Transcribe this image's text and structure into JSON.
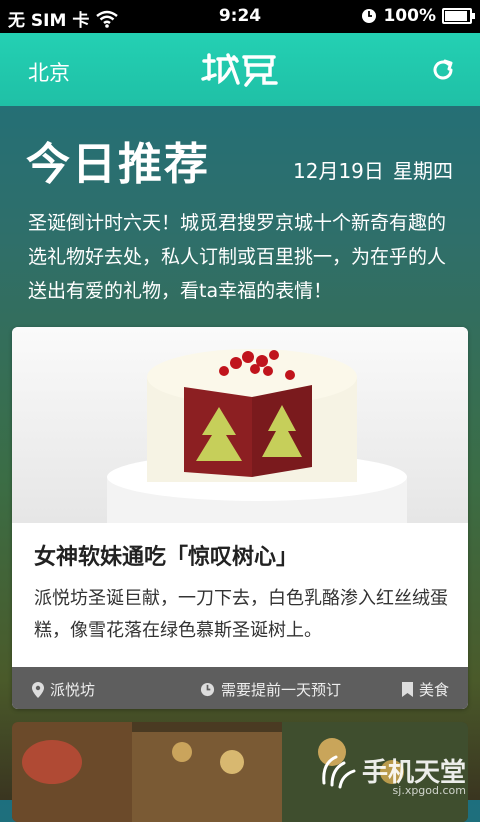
{
  "status_bar": {
    "carrier": "无 SIM 卡",
    "time": "9:24",
    "battery": "100%"
  },
  "nav": {
    "city": "北京",
    "logo_text": "城觅",
    "refresh_icon": "refresh-icon"
  },
  "hero": {
    "title": "今日推荐",
    "date": "12月19日",
    "weekday": "星期四",
    "intro": "圣诞倒计时六天！城觅君搜罗京城十个新奇有趣的选礼物好去处，私人订制或百里挑一，为在乎的人送出有爱的礼物，看ta幸福的表情！"
  },
  "card": {
    "title": "女神软妹通吃「惊叹树心」",
    "description": "派悦坊圣诞巨献，一刀下去，白色乳酪渗入红丝绒蛋糕，像雪花落在绿色慕斯圣诞树上。",
    "location": "派悦坊",
    "reservation": "需要提前一天预订",
    "category": "美食"
  },
  "watermark": {
    "text": "手机天堂",
    "url": "sj.xpgod.com"
  },
  "colors": {
    "nav_bar": "#22c9ad",
    "card_footer": "#5e5e5e"
  }
}
